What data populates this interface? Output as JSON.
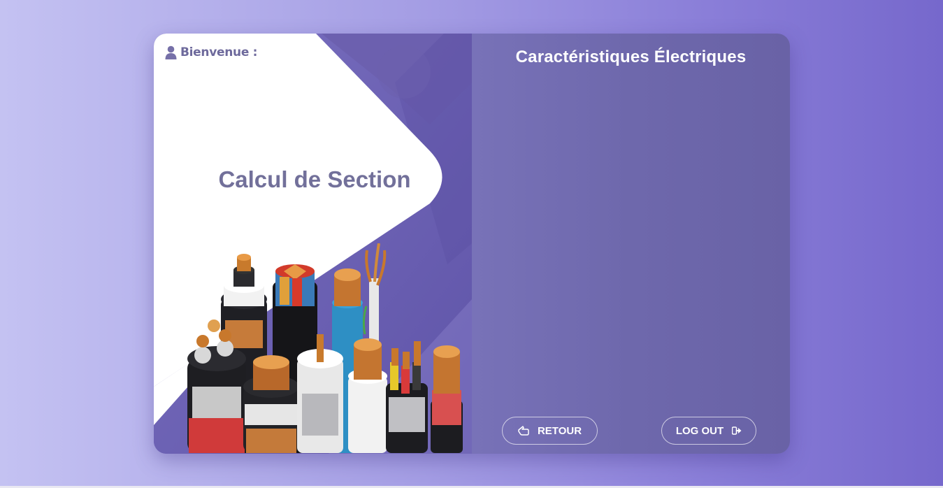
{
  "header": {
    "welcome_label": "Bienvenue :"
  },
  "left": {
    "title": "Calcul de Section",
    "image_subject": "electrical cables"
  },
  "right": {
    "title": "Caractéristiques Électriques"
  },
  "buttons": {
    "back_label": "RETOUR",
    "back_icon": "hand-left-icon",
    "logout_label": "LOG OUT",
    "logout_icon": "sign-out-icon"
  },
  "colors": {
    "accent": "#6a5fb0",
    "title_text": "#72709a",
    "panel": "#6e68ac"
  }
}
